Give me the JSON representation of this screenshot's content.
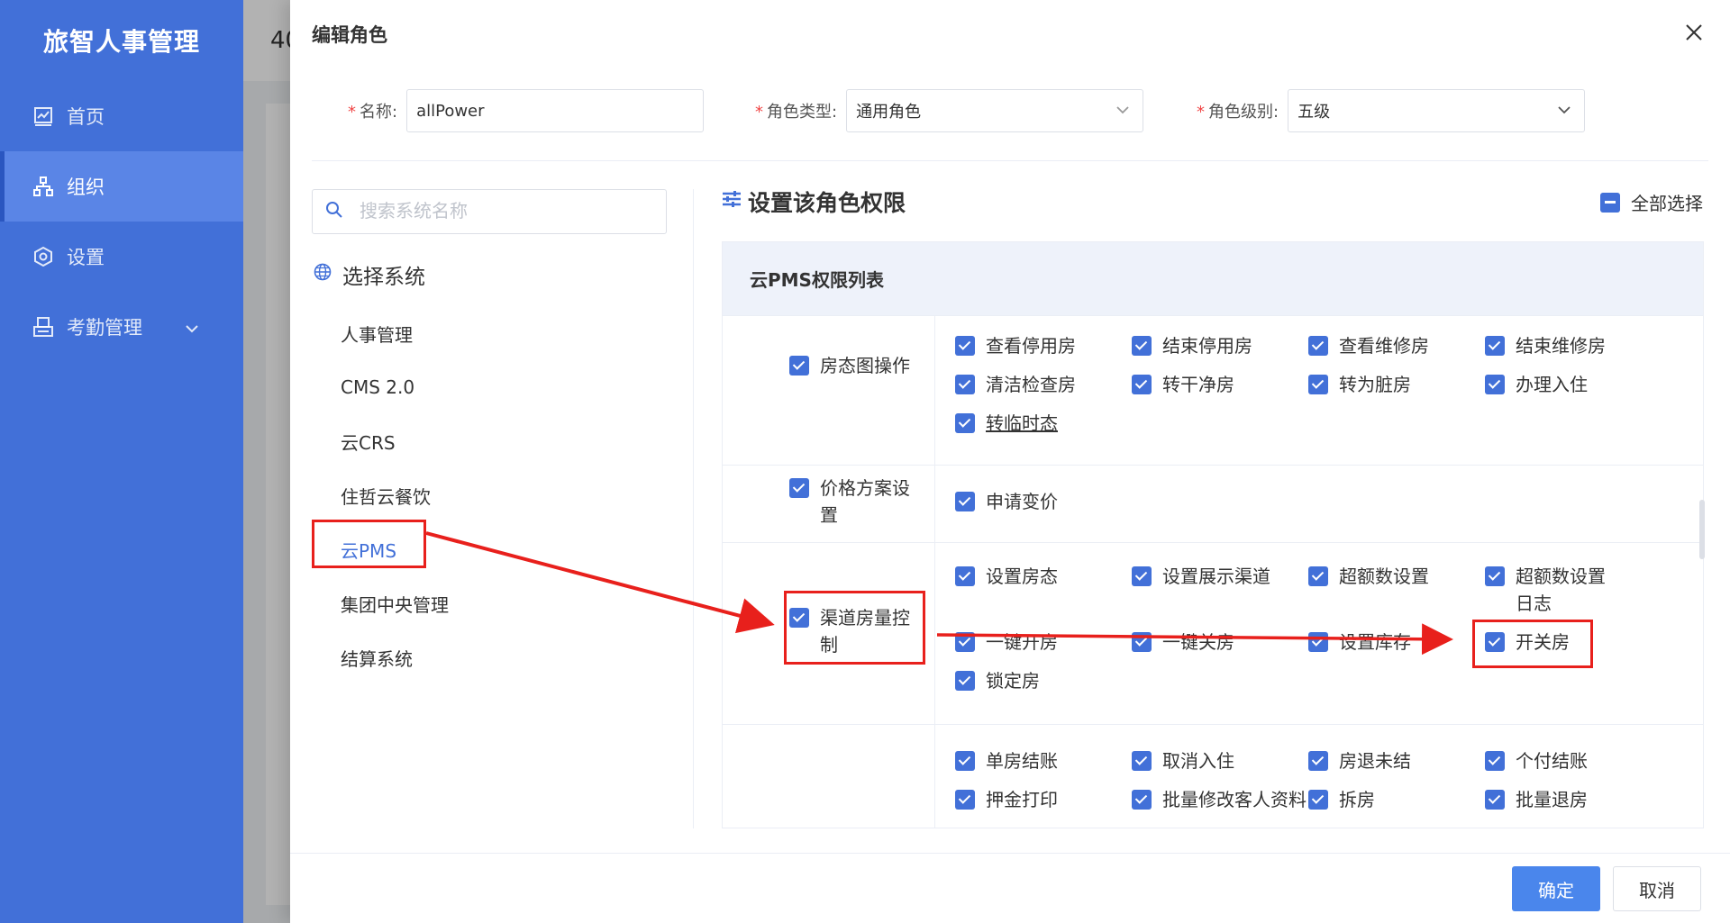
{
  "sidebar": {
    "brand": "旅智人事管理",
    "items": [
      {
        "label": "首页",
        "icon": "chart-icon"
      },
      {
        "label": "组织",
        "icon": "org-icon",
        "active": true
      },
      {
        "label": "设置",
        "icon": "gear-icon"
      },
      {
        "label": "考勤管理",
        "icon": "attendance-icon",
        "expandable": true
      }
    ]
  },
  "background": {
    "header_text": "40"
  },
  "drawer": {
    "title": "编辑角色",
    "form": {
      "name": {
        "label": "名称:",
        "value": "allPower"
      },
      "role_type": {
        "label": "角色类型:",
        "value": "通用角色"
      },
      "role_level": {
        "label": "角色级别:",
        "value": "五级"
      }
    },
    "left": {
      "search_placeholder": "搜索系统名称",
      "section_title": "选择系统",
      "systems": [
        "人事管理",
        "CMS 2.0",
        "云CRS",
        "住哲云餐饮",
        "云PMS",
        "集团中央管理",
        "结算系统"
      ],
      "selected_system": "云PMS"
    },
    "right": {
      "title": "设置该角色权限",
      "select_all": "全部选择",
      "table_title": "云PMS权限列表",
      "groups": [
        {
          "name": "房态图操作",
          "perms": [
            "查看停用房",
            "结束停用房",
            "查看维修房",
            "结束维修房",
            "清洁检查房",
            "转干净房",
            "转为脏房",
            "办理入住",
            "转临时态"
          ]
        },
        {
          "name": "价格方案设置",
          "perms": [
            "申请变价"
          ]
        },
        {
          "name": "渠道房量控制",
          "perms": [
            "设置房态",
            "设置展示渠道",
            "超额数设置",
            "超额数设置日志",
            "一键开房",
            "一键关房",
            "设置库存",
            "开关房",
            "锁定房"
          ]
        },
        {
          "name": "",
          "perms": [
            "单房结账",
            "取消入住",
            "房退未结",
            "个付结账",
            "押金打印",
            "批量修改客人资料",
            "拆房",
            "批量退房"
          ]
        }
      ]
    },
    "footer": {
      "confirm": "确定",
      "cancel": "取消"
    }
  },
  "colors": {
    "sidebar": "#4270d8",
    "primary": "#4a86ec",
    "annotation": "#e8201c"
  }
}
